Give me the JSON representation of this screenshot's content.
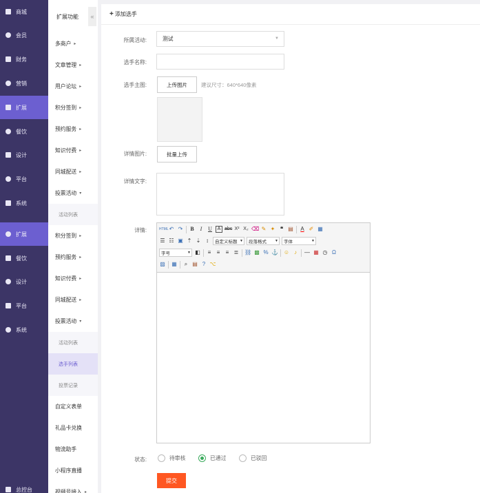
{
  "nav": {
    "items": [
      {
        "label": "商城",
        "icon": "shop-icon"
      },
      {
        "label": "会员",
        "icon": "member-icon"
      },
      {
        "label": "财务",
        "icon": "finance-icon"
      },
      {
        "label": "营销",
        "icon": "marketing-icon"
      },
      {
        "label": "扩展",
        "icon": "extension-icon"
      },
      {
        "label": "餐饮",
        "icon": "catering-icon"
      },
      {
        "label": "设计",
        "icon": "design-icon"
      },
      {
        "label": "平台",
        "icon": "platform-icon"
      },
      {
        "label": "系统",
        "icon": "system-icon"
      },
      {
        "label": "扩展",
        "icon": "extension-icon"
      },
      {
        "label": "餐饮",
        "icon": "catering-icon"
      },
      {
        "label": "设计",
        "icon": "design-icon"
      },
      {
        "label": "平台",
        "icon": "platform-icon"
      },
      {
        "label": "系统",
        "icon": "system-icon"
      },
      {
        "label": "总控台",
        "icon": "console-icon"
      }
    ],
    "active_color": "#6c5fd0",
    "bg_color": "#3c3566"
  },
  "subnav": {
    "title": "扩展功能",
    "collapse": "«",
    "items": [
      {
        "label": "多商户",
        "caret": "▸"
      },
      {
        "label": "文章管理",
        "caret": "▸"
      },
      {
        "label": "用户论坛",
        "caret": "▸"
      },
      {
        "label": "积分签到",
        "caret": "▸"
      },
      {
        "label": "预约服务",
        "caret": "▸"
      },
      {
        "label": "知识付费",
        "caret": "▸"
      },
      {
        "label": "同城配送",
        "caret": "▸"
      },
      {
        "label": "投票活动",
        "caret": "▾"
      },
      {
        "label": "活动列表",
        "caret": ""
      },
      {
        "label": "积分签到",
        "caret": "▸"
      },
      {
        "label": "预约服务",
        "caret": "▸"
      },
      {
        "label": "知识付费",
        "caret": "▸"
      },
      {
        "label": "同城配送",
        "caret": "▸"
      },
      {
        "label": "投票活动",
        "caret": "▾"
      },
      {
        "label": "活动列表",
        "caret": ""
      },
      {
        "label": "选手列表",
        "caret": ""
      },
      {
        "label": "投票记录",
        "caret": ""
      },
      {
        "label": "自定义表单",
        "caret": ""
      },
      {
        "label": "礼品卡兑换",
        "caret": ""
      },
      {
        "label": "物流助手",
        "caret": ""
      },
      {
        "label": "小程序直播",
        "caret": ""
      },
      {
        "label": "视频号接入",
        "caret": "▸"
      }
    ]
  },
  "page": {
    "header": "添加选手",
    "header_icon": "plus-icon"
  },
  "form": {
    "activity_label": "所属活动:",
    "activity_value": "测试",
    "name_label": "选手名称:",
    "name_value": "",
    "main_image_label": "选手主图:",
    "upload_btn": "上传图片",
    "size_hint": "建议尺寸：640*640像素",
    "detail_images_label": "详情图片:",
    "batch_upload_btn": "批量上传",
    "detail_text_label": "详情文字:",
    "detail_text_value": "",
    "detail_label": "详情:",
    "status_label": "状态:",
    "status_options": [
      "待审核",
      "已通过",
      "已驳回"
    ],
    "status_selected": "已通过",
    "submit": "提交",
    "submit_color": "#ff5722",
    "radio_color": "#3aaa5c"
  },
  "editor": {
    "custom_title": "自定义标题",
    "paragraph": "段落格式",
    "font_family": "字体",
    "font_size": "字号",
    "icons": [
      "html-icon",
      "undo-icon",
      "redo-icon",
      "bold-icon",
      "italic-icon",
      "underline-icon",
      "border-icon",
      "strikethrough-icon",
      "superscript-icon",
      "subscript-icon",
      "eraser-icon",
      "format-brush-icon",
      "autotype-icon",
      "blockquote-icon",
      "paste-text-icon",
      "font-color-icon",
      "highlight-icon",
      "select-all-icon"
    ]
  }
}
